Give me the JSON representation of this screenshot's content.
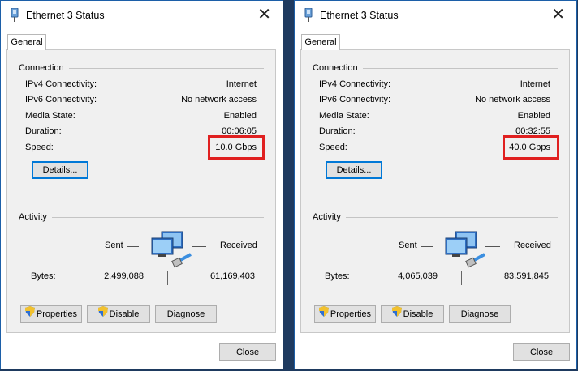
{
  "windows": [
    {
      "title": "Ethernet 3 Status",
      "tab": "General",
      "connection": {
        "heading": "Connection",
        "ipv4_label": "IPv4 Connectivity:",
        "ipv4_value": "Internet",
        "ipv6_label": "IPv6 Connectivity:",
        "ipv6_value": "No network access",
        "media_label": "Media State:",
        "media_value": "Enabled",
        "duration_label": "Duration:",
        "duration_value": "00:06:05",
        "speed_label": "Speed:",
        "speed_value": "10.0 Gbps",
        "details_button": "Details..."
      },
      "activity": {
        "heading": "Activity",
        "sent_label": "Sent",
        "received_label": "Received",
        "bytes_label": "Bytes:",
        "bytes_sent": "2,499,088",
        "bytes_received": "61,169,403"
      },
      "buttons": {
        "properties": "Properties",
        "disable": "Disable",
        "diagnose": "Diagnose",
        "close": "Close"
      }
    },
    {
      "title": "Ethernet 3 Status",
      "tab": "General",
      "connection": {
        "heading": "Connection",
        "ipv4_label": "IPv4 Connectivity:",
        "ipv4_value": "Internet",
        "ipv6_label": "IPv6 Connectivity:",
        "ipv6_value": "No network access",
        "media_label": "Media State:",
        "media_value": "Enabled",
        "duration_label": "Duration:",
        "duration_value": "00:32:55",
        "speed_label": "Speed:",
        "speed_value": "40.0 Gbps",
        "details_button": "Details..."
      },
      "activity": {
        "heading": "Activity",
        "sent_label": "Sent",
        "received_label": "Received",
        "bytes_label": "Bytes:",
        "bytes_sent": "4,065,039",
        "bytes_received": "83,591,845"
      },
      "buttons": {
        "properties": "Properties",
        "disable": "Disable",
        "diagnose": "Diagnose",
        "close": "Close"
      }
    }
  ],
  "colors": {
    "highlight": "#e02020",
    "accent": "#0078d7",
    "backdrop": "#1e3a5f"
  },
  "icons": {
    "title": "network-adapter-icon",
    "activity": "network-computers-icon",
    "buttons": "uac-shield-icon"
  }
}
